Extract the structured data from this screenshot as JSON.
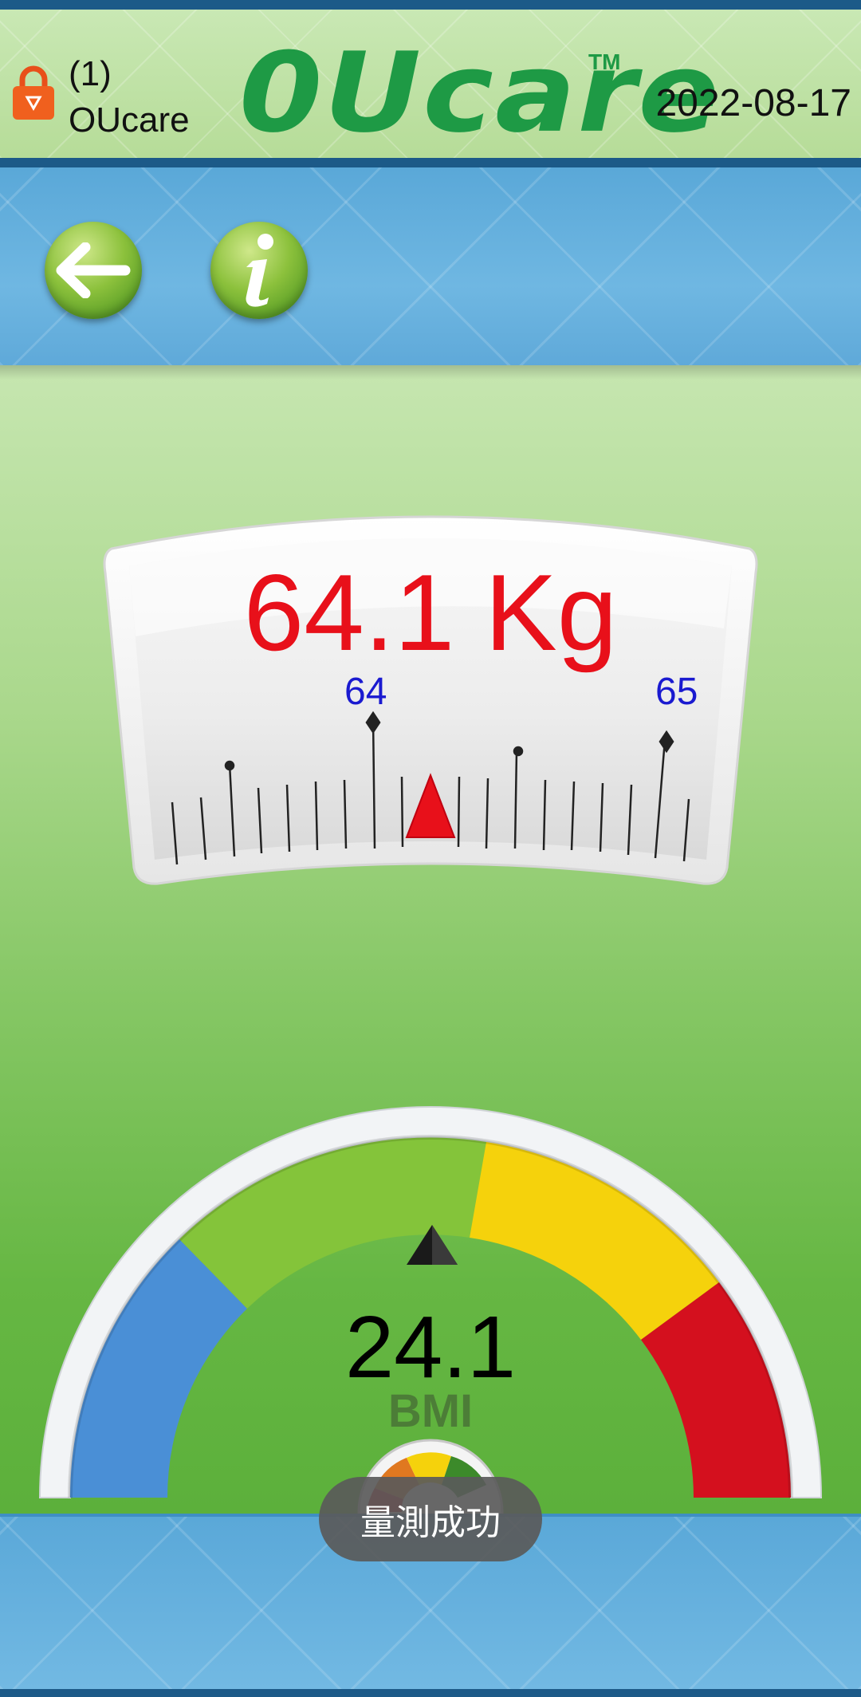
{
  "header": {
    "user_index": "(1)",
    "user_name": "OUcare",
    "logo": "0Ucare",
    "trademark": "TM",
    "date": "2022-08-17"
  },
  "toolbar": {
    "back_icon": "arrow-left-icon",
    "info_icon": "info-icon"
  },
  "weight": {
    "readout": "64.1 Kg",
    "value": 64.1,
    "unit": "Kg",
    "scale_labels": [
      "64",
      "65"
    ],
    "pointer_color": "#e8101a"
  },
  "bmi": {
    "value": "24.1",
    "label": "BMI",
    "zone_colors": [
      "#4a8fd6",
      "#84c43a",
      "#f5d20c",
      "#d4101e"
    ]
  },
  "toast": {
    "message": "量測成功"
  }
}
